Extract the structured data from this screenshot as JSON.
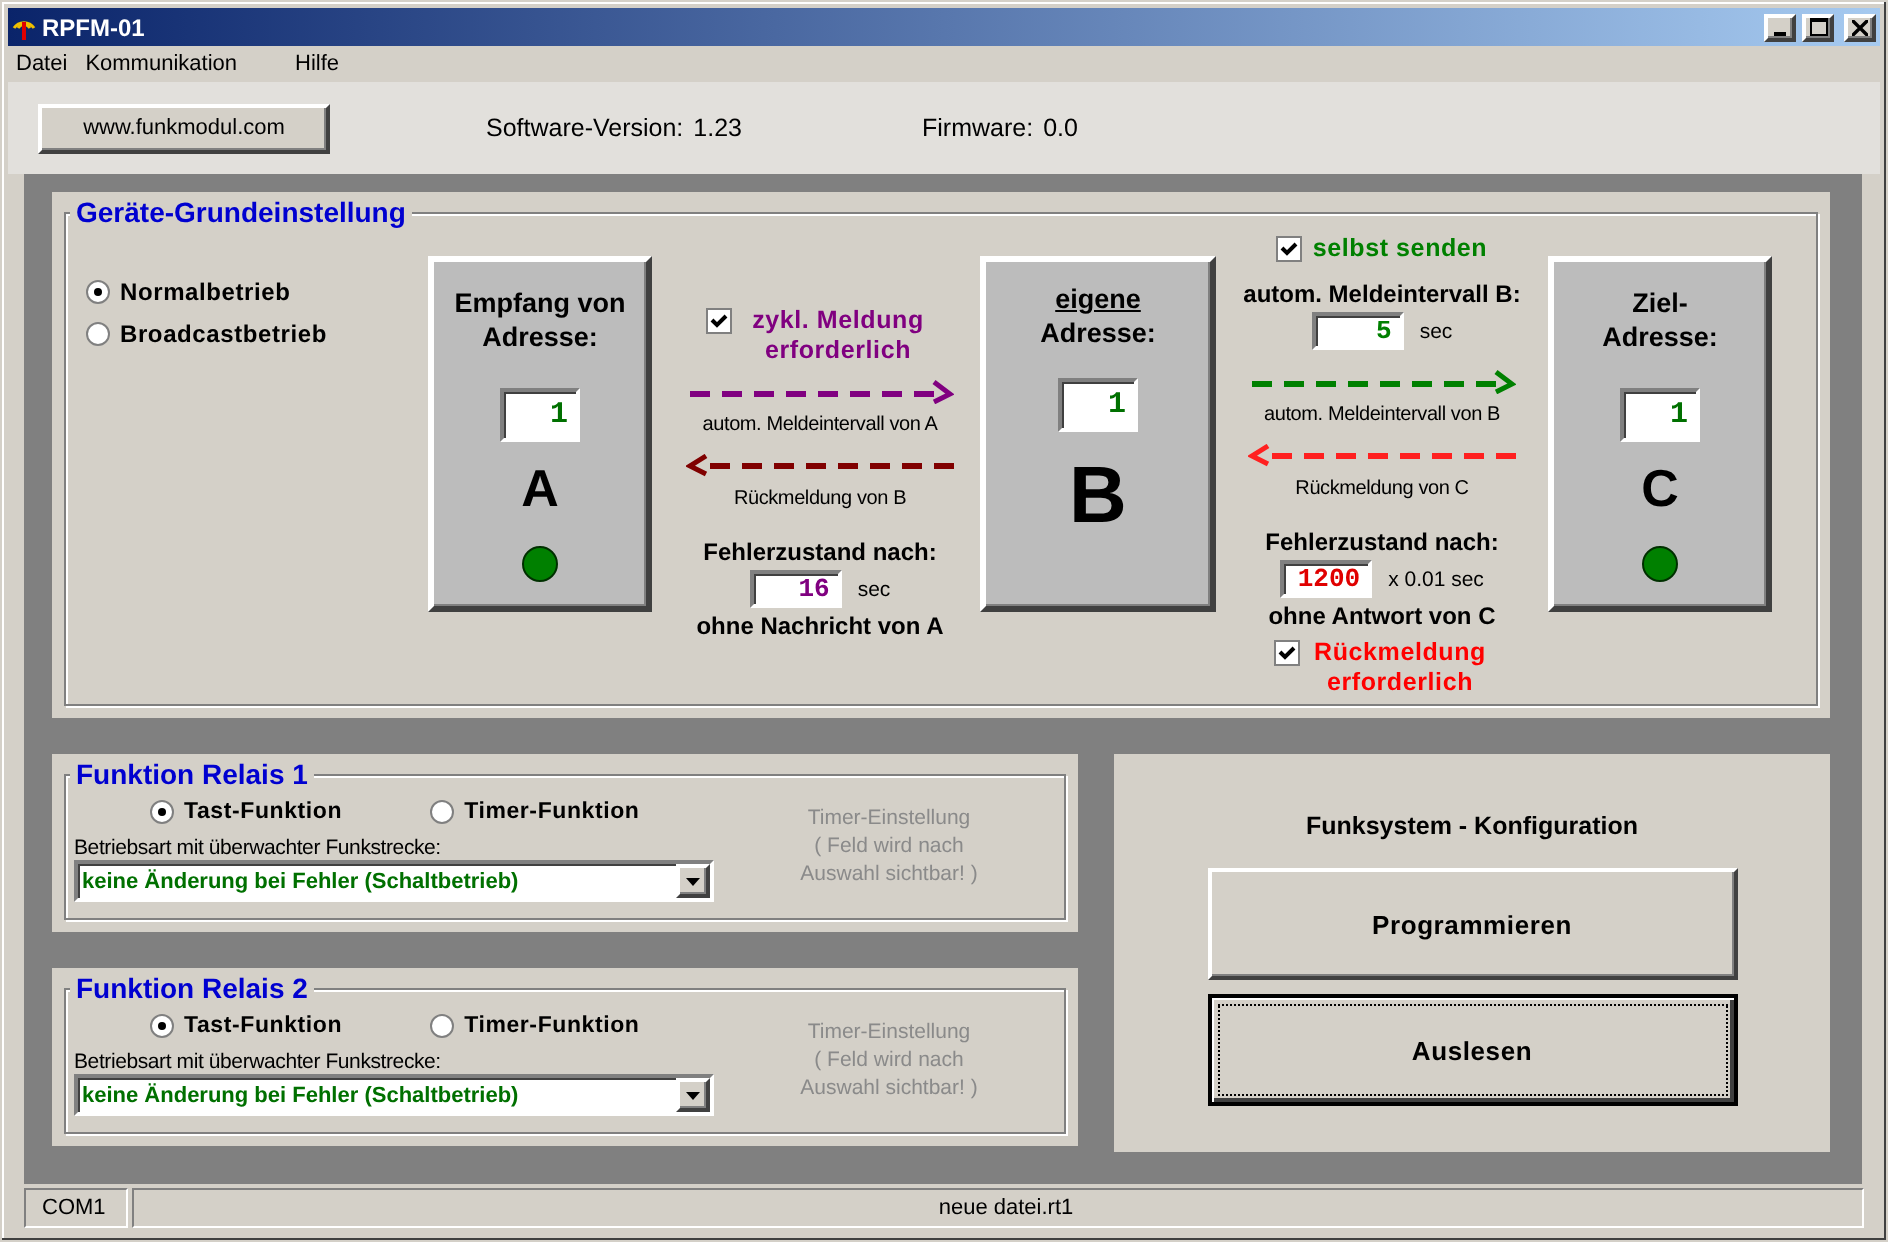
{
  "window": {
    "title": "RPFM-01"
  },
  "menu": [
    {
      "label": "Datei"
    },
    {
      "label": "Kommunikation"
    },
    {
      "label": "Hilfe"
    }
  ],
  "toolbar": {
    "website_button": "www.funkmodul.com",
    "software_version_label": "Software-Version:",
    "software_version": "1.23",
    "firmware_label": "Firmware:",
    "firmware": "0.0"
  },
  "device_settings": {
    "title": "Geräte-Grundeinstellung",
    "modes": [
      {
        "label": "Normalbetrieb",
        "selected": true
      },
      {
        "label": "Broadcastbetrieb",
        "selected": false
      }
    ],
    "nodes": [
      {
        "kind": "remote",
        "title_lines": [
          "Empfang von",
          "Adresse:"
        ],
        "first_line_underlined": false,
        "address": "1",
        "letter": "A",
        "led_on": true
      },
      {
        "kind": "own",
        "title_lines": [
          "eigene",
          "Adresse:"
        ],
        "first_line_underlined": true,
        "address": "1",
        "letter": "B"
      },
      {
        "kind": "remote",
        "title_lines": [
          "Ziel-",
          "Adresse:"
        ],
        "first_line_underlined": false,
        "address": "1",
        "letter": "C",
        "led_on": true
      }
    ],
    "links": [
      {
        "top_checkbox": {
          "label": "zykl. Meldung erforderlich",
          "checked": true
        },
        "forward_label": "autom. Meldeintervall von A",
        "back_label": "Rückmeldung von B",
        "timeout": {
          "label": "Fehlerzustand nach:",
          "value": "16",
          "unit": "sec",
          "note": "ohne Nachricht von A"
        }
      },
      {
        "top_checkbox": {
          "label": "selbst senden",
          "checked": true
        },
        "interval": {
          "label": "autom. Meldeintervall B:",
          "value": "5",
          "unit": "sec"
        },
        "forward_label": "autom. Meldeintervall von B",
        "back_label": "Rückmeldung von C",
        "timeout": {
          "label": "Fehlerzustand nach:",
          "value": "1200",
          "unit": "x 0.01 sec",
          "note": "ohne Antwort von C"
        },
        "bottom_checkbox": {
          "label": "Rückmeldung erforderlich",
          "checked": true
        }
      }
    ]
  },
  "relays": [
    {
      "title": "Funktion Relais 1",
      "modes": [
        {
          "label": "Tast-Funktion",
          "selected": true
        },
        {
          "label": "Timer-Funktion",
          "selected": false
        }
      ],
      "select_label": "Betriebsart mit überwachter Funkstrecke:",
      "select_value": "keine Änderung bei Fehler (Schaltbetrieb)",
      "timer_hint": "Timer-Einstellung\n( Feld wird nach\nAuswahl sichtbar! )"
    },
    {
      "title": "Funktion Relais 2",
      "modes": [
        {
          "label": "Tast-Funktion",
          "selected": true
        },
        {
          "label": "Timer-Funktion",
          "selected": false
        }
      ],
      "select_label": "Betriebsart mit überwachter Funkstrecke:",
      "select_value": "keine Änderung bei Fehler (Schaltbetrieb)",
      "timer_hint": "Timer-Einstellung\n( Feld wird nach\nAuswahl sichtbar! )"
    }
  ],
  "configuration": {
    "title": "Funksystem - Konfiguration",
    "buttons": [
      {
        "label": "Programmieren",
        "focused": false
      },
      {
        "label": "Auslesen",
        "focused": true
      }
    ]
  },
  "status_bar": [
    {
      "text": "COM1"
    },
    {
      "text": "neue datei.rt1"
    }
  ]
}
